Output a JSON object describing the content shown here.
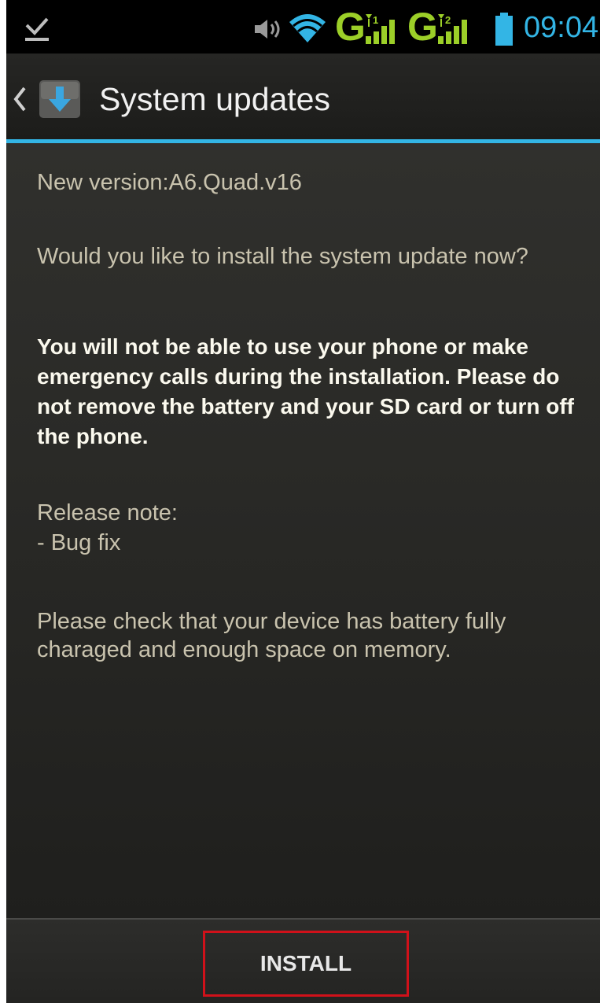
{
  "status_bar": {
    "icons": [
      "download-complete-icon",
      "volume-icon",
      "wifi-icon",
      "network-g-icon",
      "signal-sim1-icon",
      "network-g-icon",
      "signal-sim2-icon",
      "battery-icon"
    ],
    "network_1": "G",
    "network_2": "G",
    "time": "09:04"
  },
  "action_bar": {
    "back_icon": "chevron-left-icon",
    "app_icon": "system-update-icon",
    "title": "System updates"
  },
  "content": {
    "version": "New version:A6.Quad.v16",
    "question": "Would you like to install the system update now?",
    "warning": "You will not be able to use your phone or make emergency calls during the installation. Please do not remove the battery and your SD card or turn off the phone.",
    "release_label": "Release note:",
    "release_items": [
      "- Bug fix"
    ],
    "check_notice": "Please check that your device has battery fully charaged and enough space on memory."
  },
  "bottom_bar": {
    "install_label": "INSTALL"
  },
  "colors": {
    "accent": "#33b5e5",
    "signal": "#9ccf28",
    "highlight_box": "#d0111a"
  }
}
